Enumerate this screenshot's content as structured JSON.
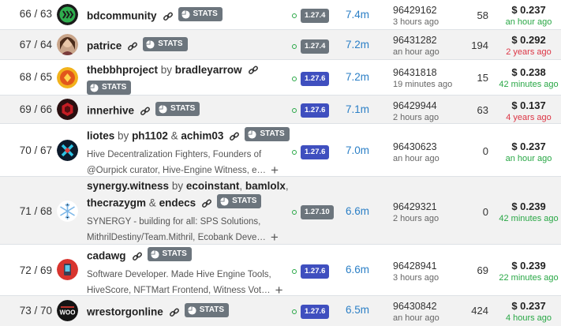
{
  "rows": [
    {
      "rank": "66 / 63",
      "name": "bdcommunity",
      "stats_label": "STATS",
      "version": "1.27.4",
      "version_color": "gray",
      "votes": "7.4m",
      "block": "96429162",
      "block_ago": "3 hours ago",
      "missed": "58",
      "price": "$ 0.237",
      "price_ago": "an hour ago",
      "price_status": "green",
      "avatar_icon": "hive-green-logo"
    },
    {
      "rank": "67 / 64",
      "name": "patrice",
      "stats_label": "STATS",
      "version": "1.27.4",
      "version_color": "gray",
      "votes": "7.2m",
      "block": "96431282",
      "block_ago": "an hour ago",
      "missed": "194",
      "price": "$ 0.292",
      "price_ago": "2 years ago",
      "price_status": "red",
      "avatar_icon": "portrait-avatar"
    },
    {
      "rank": "68 / 65",
      "name": "thebbhproject",
      "by_text": "by",
      "partner": "bradleyarrow",
      "stats_label": "STATS",
      "version": "1.27.6",
      "version_color": "blue",
      "votes": "7.2m",
      "block": "96431818",
      "block_ago": "19 minutes ago",
      "missed": "15",
      "price": "$ 0.238",
      "price_ago": "42 minutes ago",
      "price_status": "green",
      "avatar_icon": "bbh-orange-logo"
    },
    {
      "rank": "69 / 66",
      "name": "innerhive",
      "stats_label": "STATS",
      "version": "1.27.6",
      "version_color": "blue",
      "votes": "7.1m",
      "block": "96429944",
      "block_ago": "2 hours ago",
      "missed": "63",
      "price": "$ 0.137",
      "price_ago": "4 years ago",
      "price_status": "red",
      "avatar_icon": "innerhive-red-logo"
    },
    {
      "rank": "70 / 67",
      "name": "liotes",
      "by_text": "by",
      "partner": "ph1102",
      "amp": "&",
      "partner2": "achim03",
      "stats_label": "STATS",
      "desc1": "Hive Decentralization Fighters, Founders of",
      "desc2": "@Ourpick curator, Hive-Engine Witness, e…",
      "version": "1.27.6",
      "version_color": "blue",
      "votes": "7.0m",
      "block": "96430623",
      "block_ago": "an hour ago",
      "missed": "0",
      "price": "$ 0.237",
      "price_ago": "an hour ago",
      "price_status": "green",
      "avatar_icon": "liotes-cross-logo"
    },
    {
      "rank": "71 / 68",
      "name": "synergy.witness",
      "by_text": "by",
      "partner": "ecoinstant",
      "comma": ",",
      "partner2": "bamlolx",
      "comma2": ",",
      "partner3": "thecrazygm",
      "amp": "&",
      "partner4": "endecs",
      "stats_label": "STATS",
      "desc1": "SYNERGY - building for all: SPS Solutions,",
      "desc2": "MithrilDestiny/Team.Mithril, Ecobank Deve…",
      "version": "1.27.10",
      "version_color": "gray",
      "votes": "6.6m",
      "block": "96429321",
      "block_ago": "2 hours ago",
      "missed": "0",
      "price": "$ 0.239",
      "price_ago": "42 minutes ago",
      "price_status": "green",
      "avatar_icon": "snowflake-logo"
    },
    {
      "rank": "72 / 69",
      "name": "cadawg",
      "stats_label": "STATS",
      "desc1": "Software Developer. Made Hive Engine Tools,",
      "desc2": "HiveScore, NFTMart Frontend, Witness Vot…",
      "version": "1.27.6",
      "version_color": "blue",
      "votes": "6.6m",
      "block": "96428941",
      "block_ago": "3 hours ago",
      "missed": "69",
      "price": "$ 0.239",
      "price_ago": "22 minutes ago",
      "price_status": "green",
      "avatar_icon": "cadawg-red-logo"
    },
    {
      "rank": "73 / 70",
      "name": "wrestorgonline",
      "stats_label": "STATS",
      "version": "1.27.6",
      "version_color": "blue",
      "votes": "6.5m",
      "block": "96430842",
      "block_ago": "an hour ago",
      "missed": "424",
      "price": "$ 0.237",
      "price_ago": "4 hours ago",
      "price_status": "green",
      "avatar_icon": "woo-logo"
    }
  ]
}
